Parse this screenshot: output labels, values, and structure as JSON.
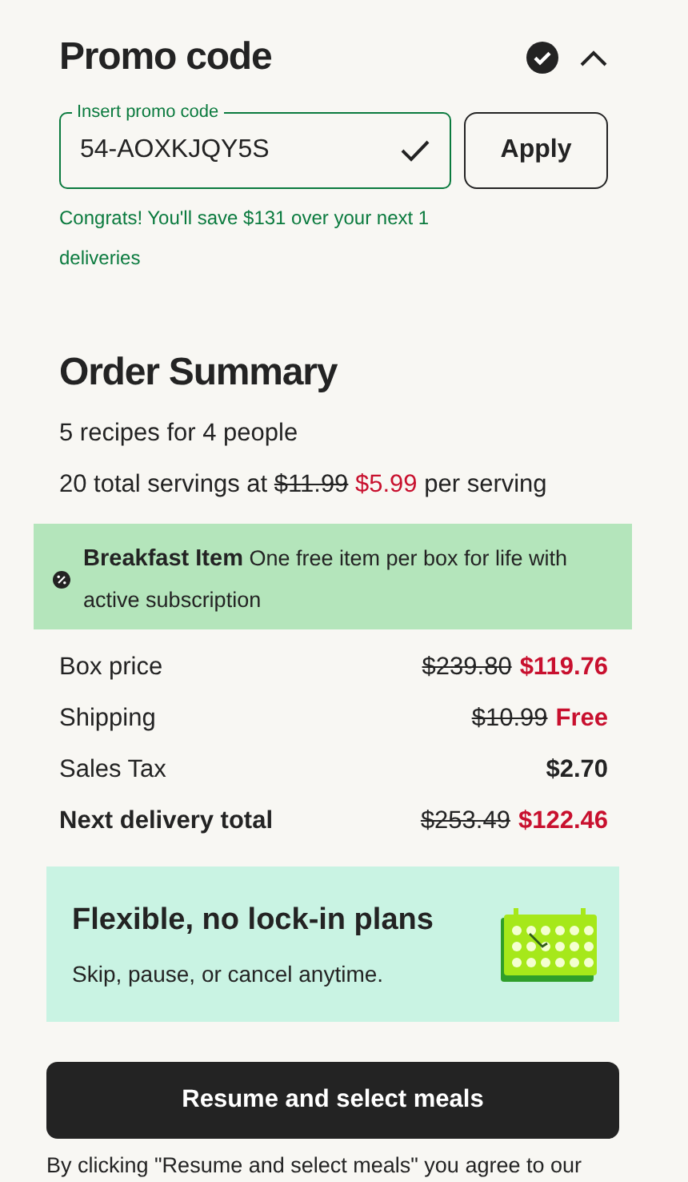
{
  "promo": {
    "title": "Promo code",
    "applied": true,
    "expanded": true,
    "field": {
      "label": "Insert promo code",
      "value": "54-AOXKJQY5S",
      "valid": true
    },
    "button": "Apply",
    "message": "Congrats! You'll save $131 over your next 1 deliveries"
  },
  "summary": {
    "title": "Order Summary",
    "recipes": "5 recipes for 4 people",
    "servings": {
      "prefix": "20 total servings at",
      "old_price": "$11.99",
      "new_price": "$5.99",
      "suffix": "per serving"
    },
    "banner": {
      "title": "Breakfast Item",
      "text": "One free item per box for life with active subscription"
    },
    "rows": [
      {
        "label": "Box price",
        "old_price": "$239.80",
        "value": "$119.76",
        "kind": "discount",
        "emphasis": false
      },
      {
        "label": "Shipping",
        "old_price": "$10.99",
        "value": "Free",
        "kind": "discount",
        "emphasis": false
      },
      {
        "label": "Sales Tax",
        "value": "$2.70",
        "kind": "plain",
        "emphasis": false
      },
      {
        "label": "Next delivery total",
        "old_price": "$253.49",
        "value": "$122.46",
        "kind": "discount",
        "emphasis": true
      }
    ]
  },
  "plans_card": {
    "title": "Flexible, no lock-in plans",
    "text": "Skip, pause, or cancel anytime."
  },
  "cta": "Resume and select meals",
  "disclaimer": "By clicking \"Resume and select meals\" you agree to our"
}
